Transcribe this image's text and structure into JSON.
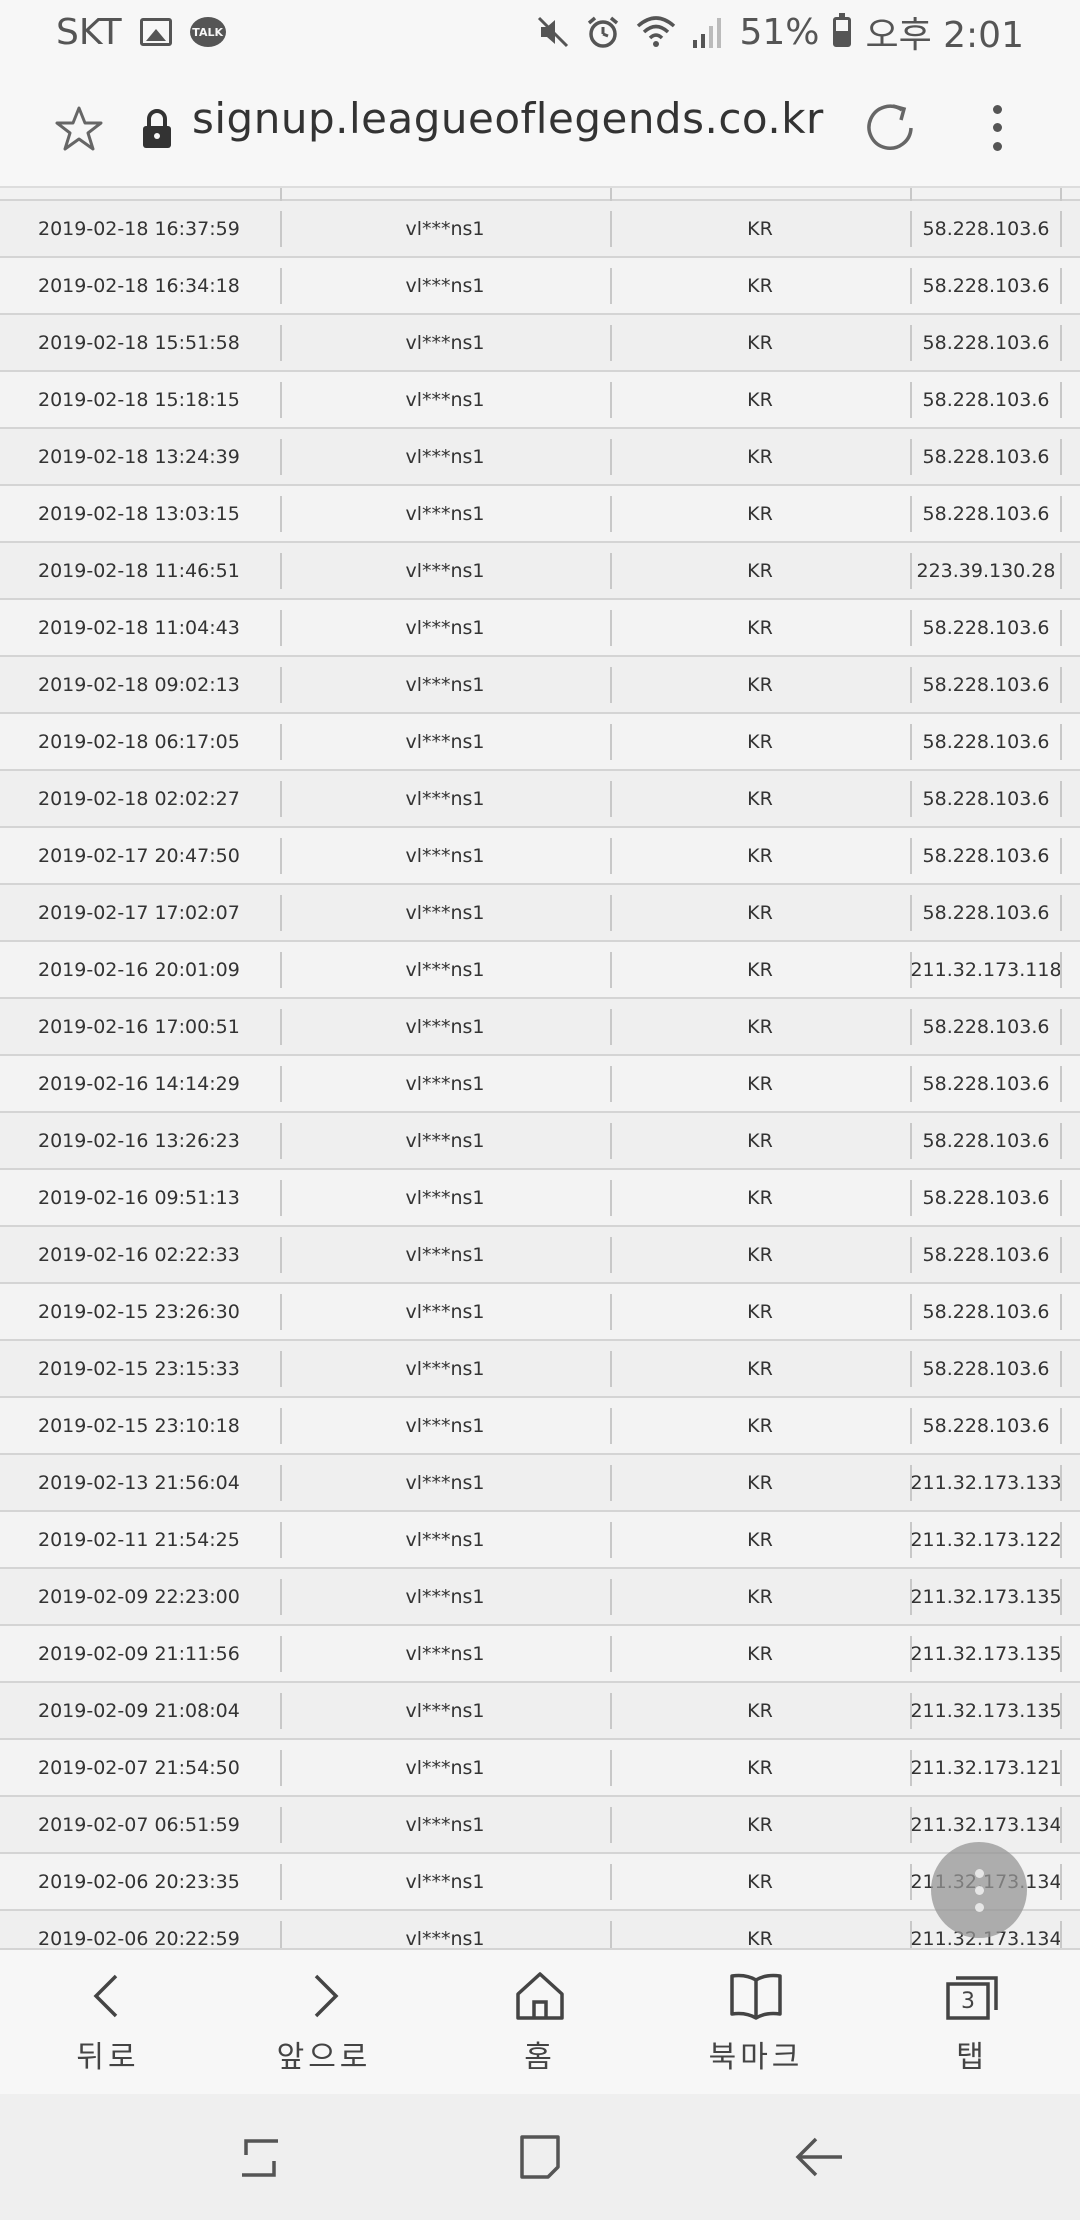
{
  "status_bar": {
    "carrier": "SKT",
    "talk_label": "TALK",
    "battery": "51%",
    "time": "오후 2:01"
  },
  "address_bar": {
    "url": "signup.leagueoflegends.co.kr"
  },
  "table": {
    "rows": [
      {
        "date": "2019-02-18 16:37:59",
        "user": "vl***ns1",
        "region": "KR",
        "ip": "58.228.103.6"
      },
      {
        "date": "2019-02-18 16:34:18",
        "user": "vl***ns1",
        "region": "KR",
        "ip": "58.228.103.6"
      },
      {
        "date": "2019-02-18 15:51:58",
        "user": "vl***ns1",
        "region": "KR",
        "ip": "58.228.103.6"
      },
      {
        "date": "2019-02-18 15:18:15",
        "user": "vl***ns1",
        "region": "KR",
        "ip": "58.228.103.6"
      },
      {
        "date": "2019-02-18 13:24:39",
        "user": "vl***ns1",
        "region": "KR",
        "ip": "58.228.103.6"
      },
      {
        "date": "2019-02-18 13:03:15",
        "user": "vl***ns1",
        "region": "KR",
        "ip": "58.228.103.6"
      },
      {
        "date": "2019-02-18 11:46:51",
        "user": "vl***ns1",
        "region": "KR",
        "ip": "223.39.130.28"
      },
      {
        "date": "2019-02-18 11:04:43",
        "user": "vl***ns1",
        "region": "KR",
        "ip": "58.228.103.6"
      },
      {
        "date": "2019-02-18 09:02:13",
        "user": "vl***ns1",
        "region": "KR",
        "ip": "58.228.103.6"
      },
      {
        "date": "2019-02-18 06:17:05",
        "user": "vl***ns1",
        "region": "KR",
        "ip": "58.228.103.6"
      },
      {
        "date": "2019-02-18 02:02:27",
        "user": "vl***ns1",
        "region": "KR",
        "ip": "58.228.103.6"
      },
      {
        "date": "2019-02-17 20:47:50",
        "user": "vl***ns1",
        "region": "KR",
        "ip": "58.228.103.6"
      },
      {
        "date": "2019-02-17 17:02:07",
        "user": "vl***ns1",
        "region": "KR",
        "ip": "58.228.103.6"
      },
      {
        "date": "2019-02-16 20:01:09",
        "user": "vl***ns1",
        "region": "KR",
        "ip": "211.32.173.118"
      },
      {
        "date": "2019-02-16 17:00:51",
        "user": "vl***ns1",
        "region": "KR",
        "ip": "58.228.103.6"
      },
      {
        "date": "2019-02-16 14:14:29",
        "user": "vl***ns1",
        "region": "KR",
        "ip": "58.228.103.6"
      },
      {
        "date": "2019-02-16 13:26:23",
        "user": "vl***ns1",
        "region": "KR",
        "ip": "58.228.103.6"
      },
      {
        "date": "2019-02-16 09:51:13",
        "user": "vl***ns1",
        "region": "KR",
        "ip": "58.228.103.6"
      },
      {
        "date": "2019-02-16 02:22:33",
        "user": "vl***ns1",
        "region": "KR",
        "ip": "58.228.103.6"
      },
      {
        "date": "2019-02-15 23:26:30",
        "user": "vl***ns1",
        "region": "KR",
        "ip": "58.228.103.6"
      },
      {
        "date": "2019-02-15 23:15:33",
        "user": "vl***ns1",
        "region": "KR",
        "ip": "58.228.103.6"
      },
      {
        "date": "2019-02-15 23:10:18",
        "user": "vl***ns1",
        "region": "KR",
        "ip": "58.228.103.6"
      },
      {
        "date": "2019-02-13 21:56:04",
        "user": "vl***ns1",
        "region": "KR",
        "ip": "211.32.173.133"
      },
      {
        "date": "2019-02-11 21:54:25",
        "user": "vl***ns1",
        "region": "KR",
        "ip": "211.32.173.122"
      },
      {
        "date": "2019-02-09 22:23:00",
        "user": "vl***ns1",
        "region": "KR",
        "ip": "211.32.173.135"
      },
      {
        "date": "2019-02-09 21:11:56",
        "user": "vl***ns1",
        "region": "KR",
        "ip": "211.32.173.135"
      },
      {
        "date": "2019-02-09 21:08:04",
        "user": "vl***ns1",
        "region": "KR",
        "ip": "211.32.173.135"
      },
      {
        "date": "2019-02-07 21:54:50",
        "user": "vl***ns1",
        "region": "KR",
        "ip": "211.32.173.121"
      },
      {
        "date": "2019-02-07 06:51:59",
        "user": "vl***ns1",
        "region": "KR",
        "ip": "211.32.173.134"
      },
      {
        "date": "2019-02-06 20:23:35",
        "user": "vl***ns1",
        "region": "KR",
        "ip": "211.32.173.134"
      },
      {
        "date": "2019-02-06 20:22:59",
        "user": "vl***ns1",
        "region": "KR",
        "ip": "211.32.173.134"
      }
    ]
  },
  "toolbar": {
    "back_label": "뒤로",
    "forward_label": "앞으로",
    "home_label": "홈",
    "bookmarks_label": "북마크",
    "tabs_label": "탭",
    "tab_count": "3"
  }
}
